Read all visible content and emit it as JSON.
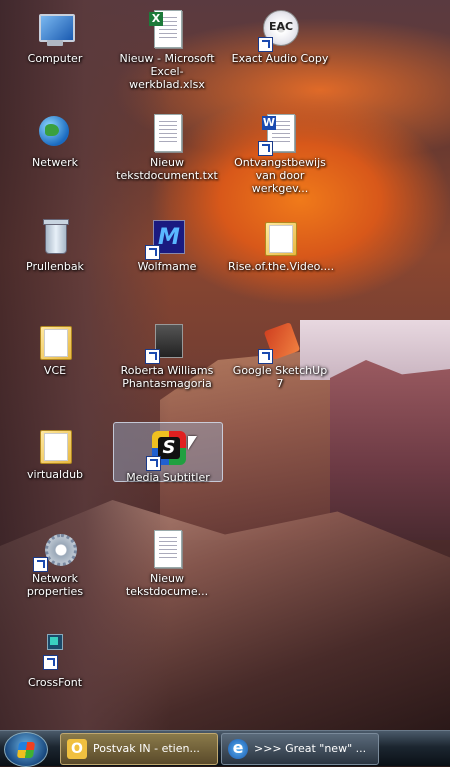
{
  "desktop": {
    "icons": [
      {
        "label": "Computer",
        "icon": "computer-icon",
        "shortcut": false
      },
      {
        "label": "Nieuw - Microsoft Excel-werkblad.xlsx",
        "icon": "excel-file-icon",
        "shortcut": false
      },
      {
        "label": "Exact Audio Copy",
        "icon": "eac-icon",
        "shortcut": true,
        "badge": "EAC"
      },
      {
        "label": "Netwerk",
        "icon": "network-icon",
        "shortcut": false
      },
      {
        "label": "Nieuw tekstdocument.txt",
        "icon": "text-file-icon",
        "shortcut": false
      },
      {
        "label": "Ontvangstbewijs van door werkgev...",
        "icon": "word-file-icon",
        "shortcut": true
      },
      {
        "label": "Prullenbak",
        "icon": "recycle-bin-icon",
        "shortcut": false
      },
      {
        "label": "Wolfmame",
        "icon": "wolfmame-icon",
        "shortcut": true
      },
      {
        "label": "Rise.of.the.Video....",
        "icon": "folder-icon",
        "shortcut": false
      },
      {
        "label": "VCE",
        "icon": "folder-icon",
        "shortcut": false
      },
      {
        "label": "Roberta Williams Phantasmagoria",
        "icon": "phantasmagoria-icon",
        "shortcut": true
      },
      {
        "label": "Google SketchUp 7",
        "icon": "sketchup-icon",
        "shortcut": true
      },
      {
        "label": "virtualdub",
        "icon": "folder-icon",
        "shortcut": false
      },
      {
        "label": "Media Subtitler",
        "icon": "media-subtitler-icon",
        "shortcut": true,
        "selected": true
      },
      {
        "label": "Network properties",
        "icon": "network-properties-icon",
        "shortcut": true
      },
      {
        "label": "Nieuw tekstdocume...",
        "icon": "text-file-icon",
        "shortcut": false
      },
      {
        "label": "CrossFont",
        "icon": "crossfont-icon",
        "shortcut": true
      }
    ]
  },
  "taskbar": {
    "start_label": "Start",
    "buttons": [
      {
        "label": "Postvak IN - etien...",
        "icon": "outlook-icon",
        "active": true
      },
      {
        "label": ">>> Great \"new\" ...",
        "icon": "internet-explorer-icon",
        "active": false
      }
    ]
  },
  "colors": {
    "selection": "#a0b4d0",
    "taskbar": "#1c2630",
    "wallpaper_accent": "#e06a28"
  }
}
